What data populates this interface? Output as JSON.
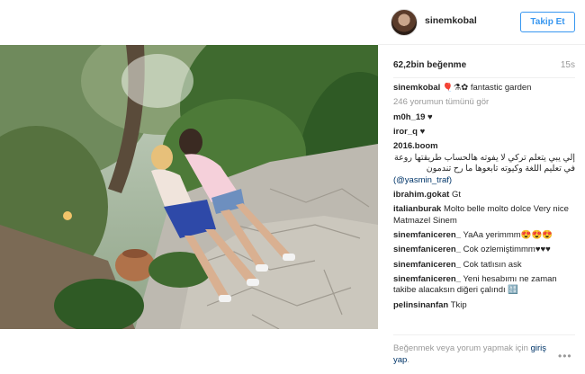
{
  "post": {
    "username": "sinemkobal",
    "follow_label": "Takip Et",
    "likes": "62,2bin beğenme",
    "time": "15s"
  },
  "caption": {
    "username": "sinemkobal",
    "text": "🎈⚗✿ fantastic garden"
  },
  "see_all": "246 yorumun tümünü gör",
  "comments": [
    {
      "user": "m0h_19",
      "text": "♥"
    },
    {
      "user": "iror_q",
      "text": "♥"
    },
    {
      "user": "2016.boom",
      "text": "إلي يبي يتعلم تركي لا يفوته هالحساب طريقتها روعة في تعليم اللغة وكيوته تابعوها ما رح تندمون",
      "mention": "(@yasmin_traf)"
    },
    {
      "user": "ibrahim.gokat",
      "text": "Gt"
    },
    {
      "user": "italianburak",
      "text": "Molto belle molto dolce Very nice Matmazel Sinem"
    },
    {
      "user": "sinemfaniceren_",
      "text": "YaAa yerimmm😍😍😍"
    },
    {
      "user": "sinemfaniceren_",
      "text": "Cok ozlemiştimmm♥♥♥"
    },
    {
      "user": "sinemfaniceren_",
      "text": "Cok tatlısın ask"
    },
    {
      "user": "sinemfaniceren_",
      "text": "Yeni hesabımı ne zaman takibe alacaksın diğeri çalındı 🔠"
    },
    {
      "user": "pelinsinanfan",
      "text": "Tkip"
    }
  ],
  "login": {
    "message": "Beğenmek veya yorum yapmak için",
    "link": "giriş yap",
    "suffix": "."
  },
  "icons": {
    "more": "more-options-icon"
  }
}
